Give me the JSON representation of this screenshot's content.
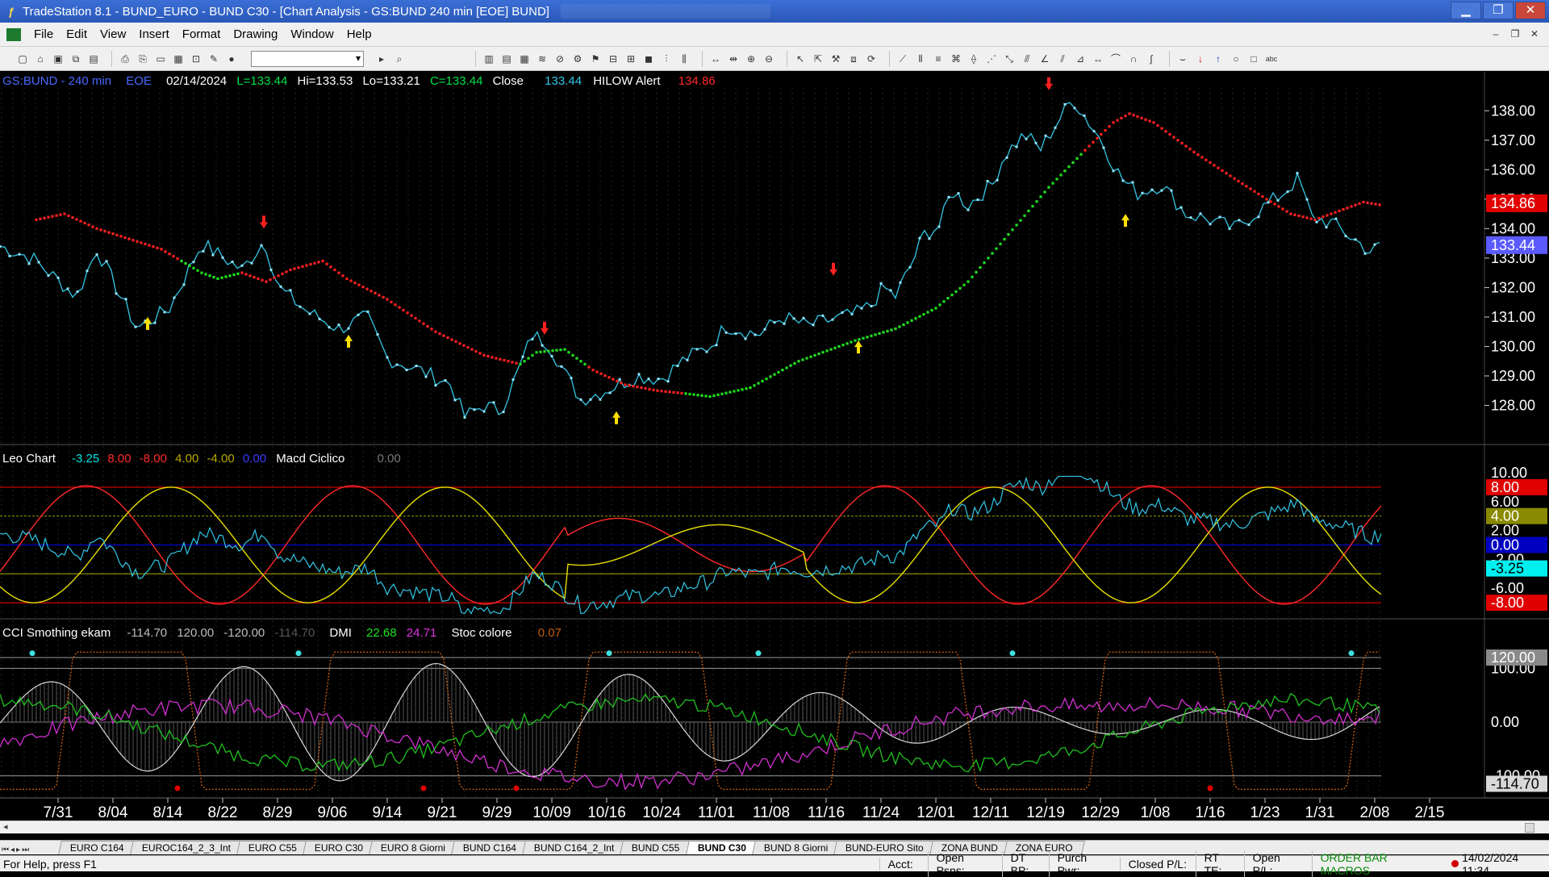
{
  "window": {
    "title": "TradeStation 8.1 - BUND_EURO - BUND  C30 - [Chart Analysis - GS:BUND  240 min  [EOE] BUND]",
    "buttons": [
      "▁",
      "❐",
      "✕"
    ]
  },
  "menu": [
    "File",
    "Edit",
    "View",
    "Insert",
    "Format",
    "Drawing",
    "Window",
    "Help"
  ],
  "price_panel": {
    "symbol": "GS:BUND - 240 min",
    "session": "EOE",
    "date": "02/14/2024",
    "last": "L=133.44",
    "high": "Hi=133.53",
    "low": "Lo=133.21",
    "close": "C=133.44",
    "close_label": "Close",
    "close_value": "133.44",
    "hilow_label": "HILOW Alert",
    "hilow_value": "134.86",
    "axis_ticks": [
      "138.00",
      "137.00",
      "136.00",
      "135.00",
      "134.00",
      "133.00",
      "132.00",
      "131.00",
      "130.00",
      "129.00",
      "128.00"
    ],
    "marker_red": "134.86",
    "marker_blue": "133.44"
  },
  "leo_panel": {
    "name": "Leo Chart",
    "values": [
      "-3.25",
      "8.00",
      "-8.00",
      "4.00",
      "-4.00",
      "0.00"
    ],
    "value_colors": [
      "#00e5e5",
      "#ff2a2a",
      "#ff2a2a",
      "#b8a800",
      "#b8a800",
      "#3a3aff"
    ],
    "macd_label": "Macd Ciclico",
    "macd_value": "0.00",
    "axis_ticks": [
      "10.00",
      "6.00",
      "2.00",
      "-2.00",
      "-6.00"
    ],
    "markers": [
      {
        "text": "8.00",
        "bg": "#e00000",
        "fg": "#ffffff"
      },
      {
        "text": "4.00",
        "bg": "#8a8a00",
        "fg": "#ffffff"
      },
      {
        "text": "0.00",
        "bg": "#0000c0",
        "fg": "#ffffff"
      },
      {
        "text": "-3.25",
        "bg": "#00f0f0",
        "fg": "#000000"
      },
      {
        "text": "-8.00",
        "bg": "#e00000",
        "fg": "#ffffff"
      }
    ]
  },
  "cci_panel": {
    "name": "CCI Smothing ekam",
    "values": [
      "-114.70",
      "120.00",
      "-120.00",
      "-114.70"
    ],
    "dmi_label": "DMI",
    "dmi_values": [
      "22.68",
      "24.71"
    ],
    "stoc_label": "Stoc colore",
    "stoc_value": "0.07",
    "axis_ticks": [
      "100.00",
      "0.00",
      "-100.00"
    ],
    "marker_120": "120.00",
    "marker_neg": "-114.70"
  },
  "dates": [
    "7/31",
    "8/04",
    "8/14",
    "8/22",
    "8/29",
    "9/06",
    "9/14",
    "9/21",
    "9/29",
    "10/09",
    "10/16",
    "10/24",
    "11/01",
    "11/08",
    "11/16",
    "11/24",
    "12/01",
    "12/11",
    "12/19",
    "12/29",
    "1/08",
    "1/16",
    "1/23",
    "1/31",
    "2/08",
    "2/15"
  ],
  "tabs": [
    "EURO C164",
    "EUROC164_2_3_Int",
    "EURO C55",
    "EURO C30",
    "EURO 8 Giorni",
    "BUND C164",
    "BUND C164_2_Int",
    "BUND C55",
    "BUND  C30",
    "BUND 8 Giorni",
    "BUND-EURO Sito",
    "ZONA BUND",
    "ZONA EURO"
  ],
  "active_tab": "BUND  C30",
  "status": {
    "help": "For Help, press F1",
    "fields": [
      "Acct:",
      "Open Psns:",
      "DT BP:",
      "Purch Pwr:",
      "Closed P/L:",
      "RT TE:",
      "Open P/L:"
    ],
    "macros": "ORDER BAR  MACROS",
    "datetime": "14/02/2024 11:34"
  },
  "colors": {
    "price_line": "#33c6e6",
    "hilow_up": "#ff2020",
    "hilow_down": "#20e020",
    "arrow_up": "#ffe000",
    "arrow_down": "#ff2020",
    "leo_red": "#ff2a2a",
    "leo_yellow": "#e8e000",
    "cci_magenta": "#d030d0",
    "dmi_green": "#20c020",
    "cci_white": "#d8d8d8",
    "stoc_orange": "#c05a10"
  }
}
